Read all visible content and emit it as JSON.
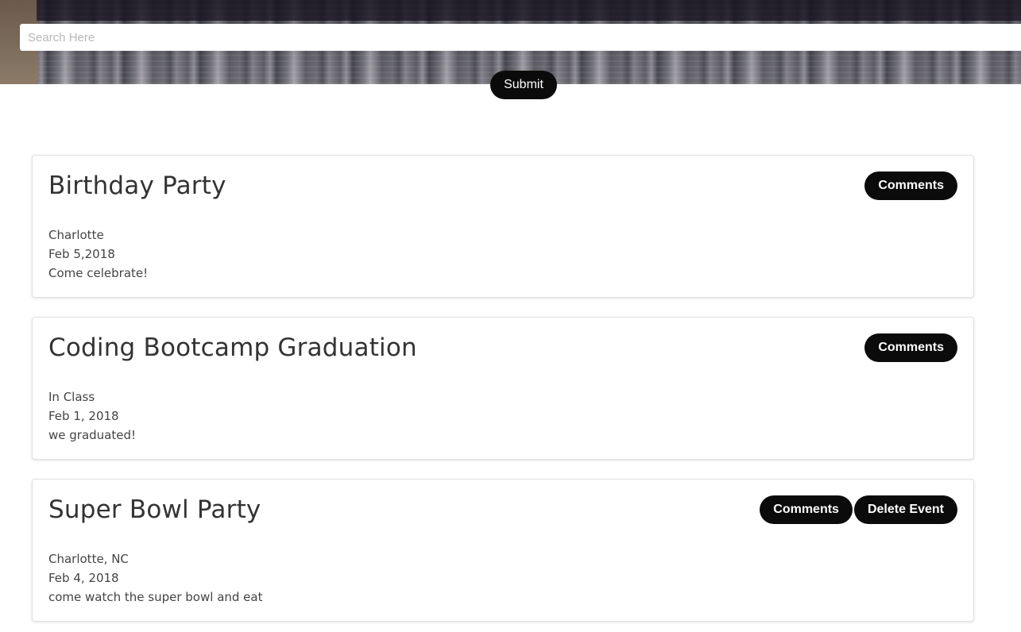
{
  "search": {
    "placeholder": "Search Here",
    "value": "",
    "submit_label": "Submit"
  },
  "events": [
    {
      "title": "Birthday Party",
      "location": "Charlotte",
      "date": "Feb 5,2018",
      "description": "Come celebrate!",
      "comments_label": "Comments"
    },
    {
      "title": "Coding Bootcamp Graduation",
      "location": "In Class",
      "date": "Feb 1, 2018",
      "description": "we graduated!",
      "comments_label": "Comments"
    },
    {
      "title": "Super Bowl Party",
      "location": "Charlotte, NC",
      "date": "Feb 4, 2018",
      "description": "come watch the super bowl and eat",
      "comments_label": "Comments",
      "delete_label": "Delete Event"
    }
  ],
  "colors": {
    "button_bg": "#0b0b0b",
    "button_text": "#ffffff",
    "card_border": "#e2e2e2",
    "title_text": "#333333"
  },
  "hero": {
    "image": "city-skyline-banner"
  }
}
